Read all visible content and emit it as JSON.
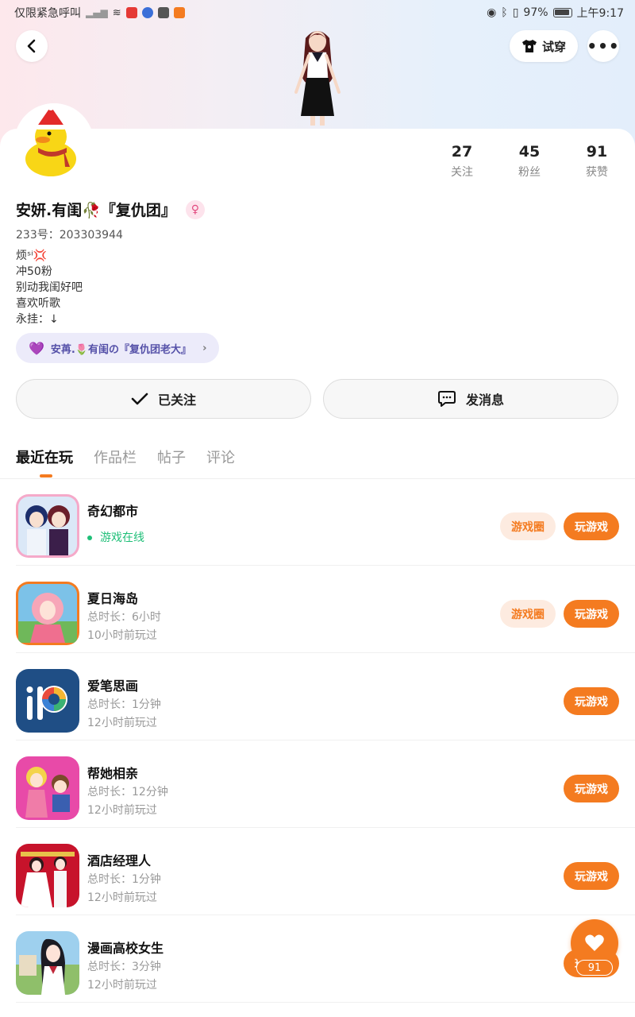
{
  "status_bar": {
    "left_text": "仅限紧急呼叫",
    "battery": "97%",
    "time": "上午9:17"
  },
  "header": {
    "tryon_label": "试穿",
    "more_label": "•••"
  },
  "profile": {
    "name": "安妍.有闺🥀『复仇团』",
    "uid": "233号：203303944",
    "bio": [
      "烦ˢⁱ💢",
      "冲50粉",
      "别动我闺好吧",
      "喜欢听歌",
      "永挂：↓"
    ],
    "badge_text": "安苒.🌷有闺の『复仇团老大』",
    "gender_symbol": "♀"
  },
  "stats": [
    {
      "num": "27",
      "label": "关注"
    },
    {
      "num": "45",
      "label": "粉丝"
    },
    {
      "num": "91",
      "label": "获赞"
    }
  ],
  "actions": {
    "follow_label": "已关注",
    "message_label": "发消息"
  },
  "tabs": [
    {
      "label": "最近在玩",
      "active": true
    },
    {
      "label": "作品栏",
      "active": false
    },
    {
      "label": "帖子",
      "active": false
    },
    {
      "label": "评论",
      "active": false
    }
  ],
  "games": [
    {
      "title": "奇幻都市",
      "status": "游戏在线",
      "circle": "游戏圈",
      "play": "玩游戏"
    },
    {
      "title": "夏日海岛",
      "meta1": "总时长：6小时",
      "meta2": "10小时前玩过",
      "circle": "游戏圈",
      "play": "玩游戏"
    },
    {
      "title": "爱笔思画",
      "meta1": "总时长：1分钟",
      "meta2": "12小时前玩过",
      "play": "玩游戏"
    },
    {
      "title": "帮她相亲",
      "meta1": "总时长：12分钟",
      "meta2": "12小时前玩过",
      "play": "玩游戏"
    },
    {
      "title": "酒店经理人",
      "meta1": "总时长：1分钟",
      "meta2": "12小时前玩过",
      "play": "玩游戏"
    },
    {
      "title": "漫画高校女生",
      "meta1": "总时长：3分钟",
      "meta2": "12小时前玩过",
      "play": "玩游戏"
    }
  ],
  "fab": {
    "count": "91"
  },
  "colors": {
    "accent": "#f47b20",
    "online": "#1fbf78",
    "badge_text": "#5450a8"
  }
}
